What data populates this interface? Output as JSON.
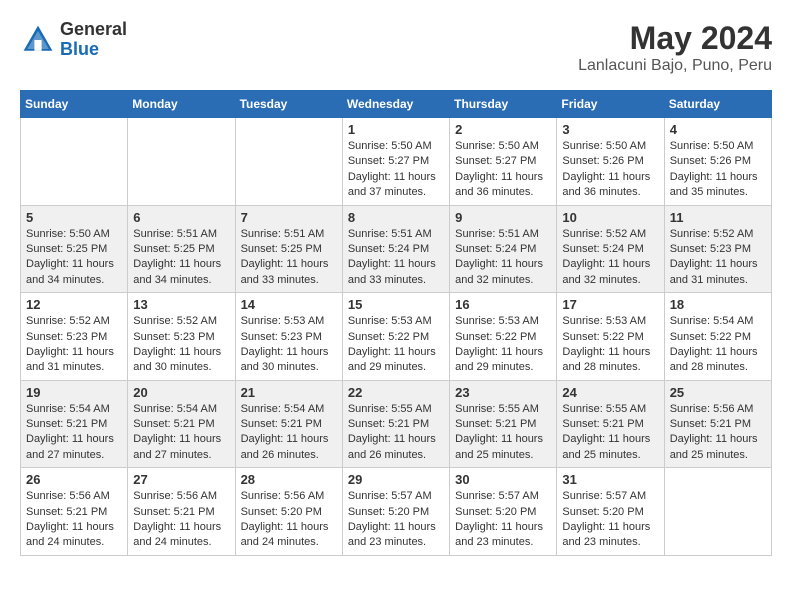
{
  "header": {
    "logo_general": "General",
    "logo_blue": "Blue",
    "month_title": "May 2024",
    "location": "Lanlacuni Bajo, Puno, Peru"
  },
  "weekdays": [
    "Sunday",
    "Monday",
    "Tuesday",
    "Wednesday",
    "Thursday",
    "Friday",
    "Saturday"
  ],
  "weeks": [
    [
      {
        "day": "",
        "info": ""
      },
      {
        "day": "",
        "info": ""
      },
      {
        "day": "",
        "info": ""
      },
      {
        "day": "1",
        "info": "Sunrise: 5:50 AM\nSunset: 5:27 PM\nDaylight: 11 hours\nand 37 minutes."
      },
      {
        "day": "2",
        "info": "Sunrise: 5:50 AM\nSunset: 5:27 PM\nDaylight: 11 hours\nand 36 minutes."
      },
      {
        "day": "3",
        "info": "Sunrise: 5:50 AM\nSunset: 5:26 PM\nDaylight: 11 hours\nand 36 minutes."
      },
      {
        "day": "4",
        "info": "Sunrise: 5:50 AM\nSunset: 5:26 PM\nDaylight: 11 hours\nand 35 minutes."
      }
    ],
    [
      {
        "day": "5",
        "info": "Sunrise: 5:50 AM\nSunset: 5:25 PM\nDaylight: 11 hours\nand 34 minutes."
      },
      {
        "day": "6",
        "info": "Sunrise: 5:51 AM\nSunset: 5:25 PM\nDaylight: 11 hours\nand 34 minutes."
      },
      {
        "day": "7",
        "info": "Sunrise: 5:51 AM\nSunset: 5:25 PM\nDaylight: 11 hours\nand 33 minutes."
      },
      {
        "day": "8",
        "info": "Sunrise: 5:51 AM\nSunset: 5:24 PM\nDaylight: 11 hours\nand 33 minutes."
      },
      {
        "day": "9",
        "info": "Sunrise: 5:51 AM\nSunset: 5:24 PM\nDaylight: 11 hours\nand 32 minutes."
      },
      {
        "day": "10",
        "info": "Sunrise: 5:52 AM\nSunset: 5:24 PM\nDaylight: 11 hours\nand 32 minutes."
      },
      {
        "day": "11",
        "info": "Sunrise: 5:52 AM\nSunset: 5:23 PM\nDaylight: 11 hours\nand 31 minutes."
      }
    ],
    [
      {
        "day": "12",
        "info": "Sunrise: 5:52 AM\nSunset: 5:23 PM\nDaylight: 11 hours\nand 31 minutes."
      },
      {
        "day": "13",
        "info": "Sunrise: 5:52 AM\nSunset: 5:23 PM\nDaylight: 11 hours\nand 30 minutes."
      },
      {
        "day": "14",
        "info": "Sunrise: 5:53 AM\nSunset: 5:23 PM\nDaylight: 11 hours\nand 30 minutes."
      },
      {
        "day": "15",
        "info": "Sunrise: 5:53 AM\nSunset: 5:22 PM\nDaylight: 11 hours\nand 29 minutes."
      },
      {
        "day": "16",
        "info": "Sunrise: 5:53 AM\nSunset: 5:22 PM\nDaylight: 11 hours\nand 29 minutes."
      },
      {
        "day": "17",
        "info": "Sunrise: 5:53 AM\nSunset: 5:22 PM\nDaylight: 11 hours\nand 28 minutes."
      },
      {
        "day": "18",
        "info": "Sunrise: 5:54 AM\nSunset: 5:22 PM\nDaylight: 11 hours\nand 28 minutes."
      }
    ],
    [
      {
        "day": "19",
        "info": "Sunrise: 5:54 AM\nSunset: 5:21 PM\nDaylight: 11 hours\nand 27 minutes."
      },
      {
        "day": "20",
        "info": "Sunrise: 5:54 AM\nSunset: 5:21 PM\nDaylight: 11 hours\nand 27 minutes."
      },
      {
        "day": "21",
        "info": "Sunrise: 5:54 AM\nSunset: 5:21 PM\nDaylight: 11 hours\nand 26 minutes."
      },
      {
        "day": "22",
        "info": "Sunrise: 5:55 AM\nSunset: 5:21 PM\nDaylight: 11 hours\nand 26 minutes."
      },
      {
        "day": "23",
        "info": "Sunrise: 5:55 AM\nSunset: 5:21 PM\nDaylight: 11 hours\nand 25 minutes."
      },
      {
        "day": "24",
        "info": "Sunrise: 5:55 AM\nSunset: 5:21 PM\nDaylight: 11 hours\nand 25 minutes."
      },
      {
        "day": "25",
        "info": "Sunrise: 5:56 AM\nSunset: 5:21 PM\nDaylight: 11 hours\nand 25 minutes."
      }
    ],
    [
      {
        "day": "26",
        "info": "Sunrise: 5:56 AM\nSunset: 5:21 PM\nDaylight: 11 hours\nand 24 minutes."
      },
      {
        "day": "27",
        "info": "Sunrise: 5:56 AM\nSunset: 5:21 PM\nDaylight: 11 hours\nand 24 minutes."
      },
      {
        "day": "28",
        "info": "Sunrise: 5:56 AM\nSunset: 5:20 PM\nDaylight: 11 hours\nand 24 minutes."
      },
      {
        "day": "29",
        "info": "Sunrise: 5:57 AM\nSunset: 5:20 PM\nDaylight: 11 hours\nand 23 minutes."
      },
      {
        "day": "30",
        "info": "Sunrise: 5:57 AM\nSunset: 5:20 PM\nDaylight: 11 hours\nand 23 minutes."
      },
      {
        "day": "31",
        "info": "Sunrise: 5:57 AM\nSunset: 5:20 PM\nDaylight: 11 hours\nand 23 minutes."
      },
      {
        "day": "",
        "info": ""
      }
    ]
  ]
}
